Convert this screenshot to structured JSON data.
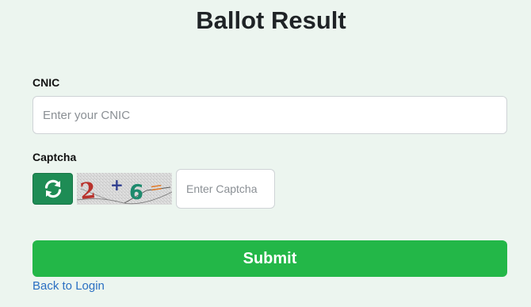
{
  "page": {
    "title": "Ballot Result"
  },
  "form": {
    "cnic": {
      "label": "CNIC",
      "placeholder": "Enter your CNIC",
      "value": ""
    },
    "captcha": {
      "label": "Captcha",
      "placeholder": "Enter Captcha",
      "value": "",
      "image_chars": [
        "2",
        "+",
        "6",
        "="
      ],
      "refresh_icon": "refresh-icon"
    },
    "submit_label": "Submit",
    "back_link": "Back to Login"
  },
  "colors": {
    "background": "#ecf5ef",
    "submit": "#23b748",
    "refresh": "#1e8c55",
    "link": "#2a6fc2"
  }
}
